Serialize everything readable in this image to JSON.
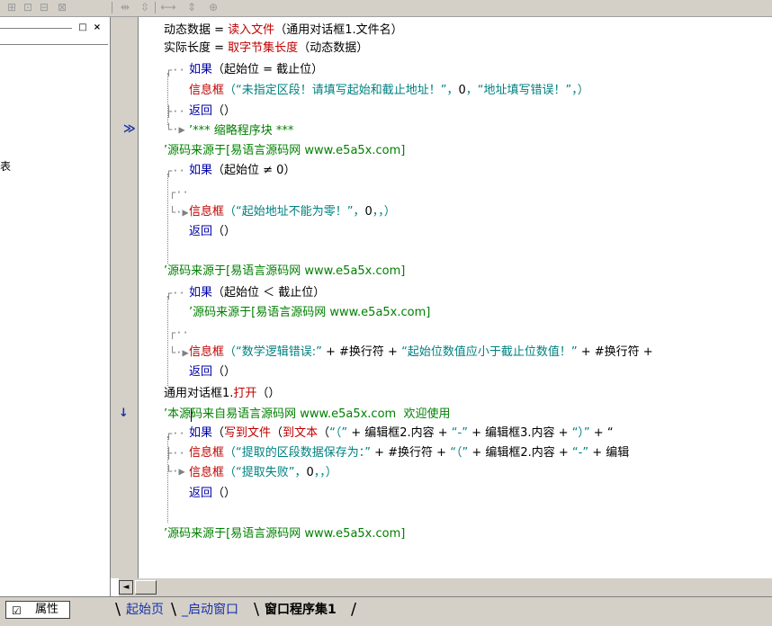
{
  "toolbar": {
    "icons": [
      "table-icon",
      "form-icon",
      "align-icon",
      "align2-icon",
      "width-icon",
      "height-icon",
      "expand-icon",
      "fit-icon"
    ]
  },
  "left_panel": {
    "partial_char": "表",
    "btn_restore": "□",
    "btn_close": "×"
  },
  "gutter": {
    "marker_jump": "≫",
    "marker_arrow": "↓"
  },
  "code": [
    {
      "parts": [
        [
          "",
          "动态数据 = "
        ],
        [
          "fn",
          "读入文件"
        ],
        [
          "",
          "（通用对话框1.文件名）"
        ]
      ]
    },
    {
      "parts": [
        [
          "",
          "实际长度 = "
        ],
        [
          "fn",
          "取字节集长度"
        ],
        [
          "",
          "（动态数据）"
        ]
      ]
    },
    {
      "parts": [
        [
          "kw",
          "如果"
        ],
        [
          "",
          "（起始位 = 截止位）"
        ]
      ]
    },
    {
      "parts": [
        [
          "fn",
          "信息框"
        ],
        [
          "st",
          "（“未指定区段！请填写起始和截止地址！”，"
        ],
        [
          "",
          "0"
        ],
        [
          "st",
          "，“地址填写错误！”，）"
        ]
      ]
    },
    {
      "parts": [
        [
          "kw",
          "返回"
        ],
        [
          "",
          "（）"
        ]
      ]
    },
    {
      "parts": [
        [
          "cm",
          "’*** 缩略程序块 ***"
        ]
      ]
    },
    {
      "parts": [
        [
          "cm",
          "’源码来源于[易语言源码网 "
        ],
        [
          "cm mono",
          "www.e5a5x.com"
        ],
        [
          "cm",
          "]"
        ]
      ]
    },
    {
      "parts": [
        [
          "kw",
          "如果"
        ],
        [
          "",
          "（起始位 ≠ 0）"
        ]
      ]
    },
    {
      "parts": [
        [
          "fn",
          "信息框"
        ],
        [
          "st",
          "（“起始地址不能为零！”，"
        ],
        [
          "",
          "0"
        ],
        [
          "st",
          "，，）"
        ]
      ]
    },
    {
      "parts": [
        [
          "kw",
          "返回"
        ],
        [
          "",
          "（）"
        ]
      ]
    },
    {
      "parts": [
        [
          "cm",
          "’源码来源于[易语言源码网 "
        ],
        [
          "cm mono",
          "www.e5a5x.com"
        ],
        [
          "cm",
          "]"
        ]
      ]
    },
    {
      "parts": [
        [
          "kw",
          "如果"
        ],
        [
          "",
          "（起始位 ＜ 截止位）"
        ]
      ]
    },
    {
      "parts": [
        [
          "cm",
          "’源码来源于[易语言源码网 "
        ],
        [
          "cm mono",
          "www.e5a5x.com"
        ],
        [
          "cm",
          "]"
        ]
      ]
    },
    {
      "parts": [
        [
          "fn",
          "信息框"
        ],
        [
          "st",
          "（“数学逻辑错误:”"
        ],
        [
          "",
          " + #换行符 + "
        ],
        [
          "st",
          "“起始位数值应小于截止位数值！”"
        ],
        [
          "",
          " + #换行符 +"
        ]
      ]
    },
    {
      "parts": [
        [
          "kw",
          "返回"
        ],
        [
          "",
          "（）"
        ]
      ]
    },
    {
      "parts": [
        [
          "",
          "通用对话框1."
        ],
        [
          "fn",
          "打开"
        ],
        [
          "",
          "（）"
        ]
      ]
    },
    {
      "parts": [
        [
          "cm",
          "’本源码来自易语言源码网 "
        ],
        [
          "cm mono",
          "www.e5a5x.com"
        ],
        [
          "cm",
          "  欢迎使用"
        ]
      ]
    },
    {
      "parts": [
        [
          "kw",
          "如果"
        ],
        [
          "",
          "（"
        ],
        [
          "fn",
          "写到文件"
        ],
        [
          "",
          "（"
        ],
        [
          "fn",
          "到文本"
        ],
        [
          "",
          "（"
        ],
        [
          "st",
          "“（”"
        ],
        [
          "",
          " + 编辑框2.内容 + "
        ],
        [
          "st",
          "“-”"
        ],
        [
          "",
          " + 编辑框3.内容 + "
        ],
        [
          "st",
          "“）”"
        ],
        [
          "",
          " + “"
        ]
      ]
    },
    {
      "parts": [
        [
          "fn",
          "信息框"
        ],
        [
          "st",
          "（“提取的区段数据保存为：”"
        ],
        [
          "",
          " + #换行符 + "
        ],
        [
          "st",
          "“（”"
        ],
        [
          "",
          " + 编辑框2.内容 + "
        ],
        [
          "st",
          "“-”"
        ],
        [
          "",
          " + 编辑"
        ]
      ]
    },
    {
      "parts": [
        [
          "fn",
          "信息框"
        ],
        [
          "st",
          "（“提取失败”，"
        ],
        [
          "",
          "0"
        ],
        [
          "st",
          "，，）"
        ]
      ]
    },
    {
      "parts": [
        [
          "kw",
          "返回"
        ],
        [
          "",
          "（）"
        ]
      ]
    },
    {
      "parts": [
        [
          "cm",
          "’源码来源于[易语言源码网 "
        ],
        [
          "cm mono",
          "www.e5a5x.com"
        ],
        [
          "cm",
          "]"
        ]
      ]
    }
  ],
  "scroll": {
    "left_arrow": "◄"
  },
  "bottom": {
    "prop_label": "属性",
    "tabs": [
      "起始页",
      "_启动窗口",
      "窗口程序集1"
    ]
  }
}
